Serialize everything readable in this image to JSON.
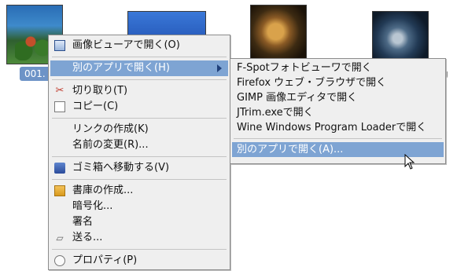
{
  "desktop": {
    "file1_label": "001.",
    "file4_label_partial": "g"
  },
  "context_menu": {
    "items": [
      {
        "label": "画像ビューアで開く(O)",
        "icon": "image-viewer-icon"
      },
      {
        "label": "別のアプリで開く(H)",
        "icon": "none",
        "has_submenu": true,
        "active": true
      },
      {
        "label": "切り取り(T)",
        "icon": "scissors-icon"
      },
      {
        "label": "コピー(C)",
        "icon": "copy-icon"
      },
      {
        "label": "リンクの作成(K)"
      },
      {
        "label": "名前の変更(R)..."
      },
      {
        "label": "ゴミ箱へ移動する(V)",
        "icon": "trash-icon"
      },
      {
        "label": "書庫の作成...",
        "icon": "archive-icon"
      },
      {
        "label": "暗号化..."
      },
      {
        "label": "署名"
      },
      {
        "label": "送る...",
        "icon": "send-icon"
      },
      {
        "label": "プロパティ(P)",
        "icon": "properties-icon"
      }
    ]
  },
  "submenu": {
    "items": [
      {
        "label": "F-Spotフォトビューワで開く"
      },
      {
        "label": "Firefox ウェブ・ブラウザで開く"
      },
      {
        "label": "GIMP 画像エディタで開く"
      },
      {
        "label": "JTrim.exeで開く"
      },
      {
        "label": "Wine Windows Program Loaderで開く"
      },
      {
        "label": "別のアプリで開く(A)...",
        "active": true
      }
    ]
  },
  "colors": {
    "highlight": "#7ea4d3",
    "menu_bg": "#efefef"
  }
}
